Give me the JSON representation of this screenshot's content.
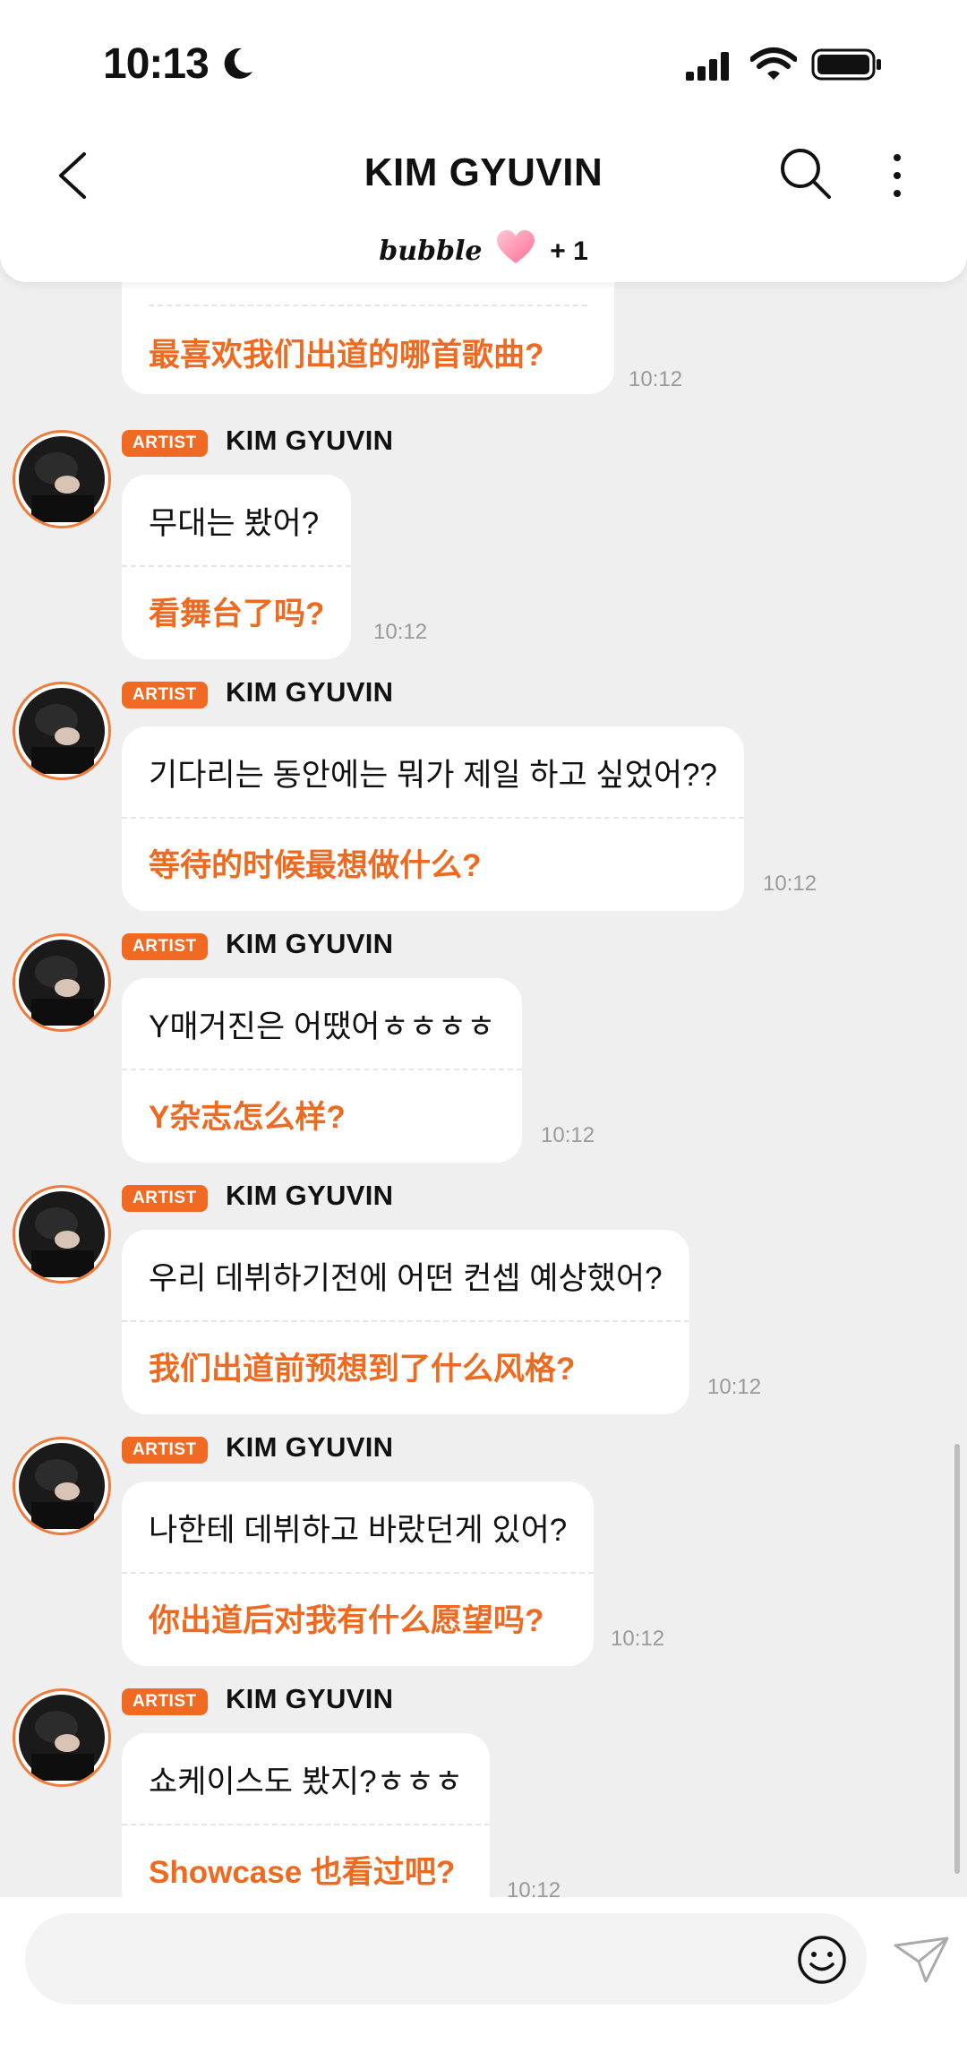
{
  "status": {
    "time": "10:13"
  },
  "header": {
    "title": "KIM GYUVIN",
    "brand": "bubble",
    "plus": "+ 1"
  },
  "first_message": {
    "translation": "最喜欢我们出道的哪首歌曲?",
    "time": "10:12"
  },
  "messages": [
    {
      "badge": "ARTIST",
      "sender": "KIM GYUVIN",
      "text": "무대는 봤어?",
      "translation": "看舞台了吗?",
      "time": "10:12"
    },
    {
      "badge": "ARTIST",
      "sender": "KIM GYUVIN",
      "text": "기다리는 동안에는 뭐가 제일 하고 싶었어??",
      "translation": "等待的时候最想做什么?",
      "time": "10:12"
    },
    {
      "badge": "ARTIST",
      "sender": "KIM GYUVIN",
      "text": "Y매거진은 어땠어ㅎㅎㅎㅎ",
      "translation": "Y杂志怎么样?",
      "time": "10:12"
    },
    {
      "badge": "ARTIST",
      "sender": "KIM GYUVIN",
      "text": "우리 데뷔하기전에 어떤 컨셉 예상했어?",
      "translation": "我们出道前预想到了什么风格?",
      "time": "10:12"
    },
    {
      "badge": "ARTIST",
      "sender": "KIM GYUVIN",
      "text": "나한테 데뷔하고 바랐던게 있어?",
      "translation": "你出道后对我有什么愿望吗?",
      "time": "10:12"
    },
    {
      "badge": "ARTIST",
      "sender": "KIM GYUVIN",
      "text": "쇼케이스도 봤지?ㅎㅎㅎ",
      "translation": "Showcase 也看过吧?",
      "time": "10:12"
    }
  ],
  "input": {
    "placeholder": ""
  },
  "colors": {
    "accent": "#ee6a21",
    "background": "#efefef"
  },
  "icons": [
    "back-chevron-icon",
    "search-icon",
    "more-vertical-icon",
    "heart-icon",
    "emoji-icon",
    "send-icon",
    "moon-icon",
    "signal-icon",
    "wifi-icon",
    "battery-icon"
  ]
}
